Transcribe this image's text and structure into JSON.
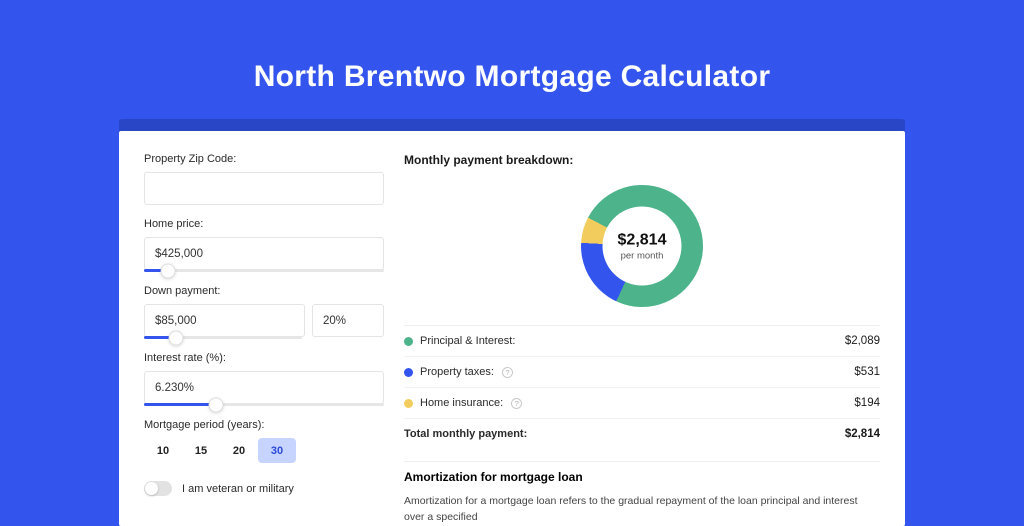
{
  "title": "North Brentwo Mortgage Calculator",
  "colors": {
    "principal": "#4cb38a",
    "taxes": "#3355ee",
    "insurance": "#f2cd5d"
  },
  "form": {
    "zip_label": "Property Zip Code:",
    "zip_value": "",
    "home_price_label": "Home price:",
    "home_price": "$425,000",
    "home_price_slider_pct": 10,
    "down_label": "Down payment:",
    "down_amount": "$85,000",
    "down_pct": "20%",
    "down_slider_pct": 20,
    "rate_label": "Interest rate (%):",
    "rate": "6.230%",
    "rate_slider_pct": 30,
    "period_label": "Mortgage period (years):",
    "periods": [
      "10",
      "15",
      "20",
      "30"
    ],
    "period_active": "30",
    "veteran_label": "I am veteran or military"
  },
  "breakdown": {
    "title": "Monthly payment breakdown:",
    "center_amount": "$2,814",
    "center_sub": "per month",
    "items": [
      {
        "key": "principal",
        "label": "Principal & Interest:",
        "value": "$2,089",
        "help": false
      },
      {
        "key": "taxes",
        "label": "Property taxes:",
        "value": "$531",
        "help": true
      },
      {
        "key": "insurance",
        "label": "Home insurance:",
        "value": "$194",
        "help": true
      }
    ],
    "total_label": "Total monthly payment:",
    "total_value": "$2,814"
  },
  "chart_data": {
    "type": "pie",
    "title": "Monthly payment breakdown",
    "categories": [
      "Principal & Interest",
      "Property taxes",
      "Home insurance"
    ],
    "values": [
      2089,
      531,
      194
    ],
    "total": 2814,
    "unit": "$ per month"
  },
  "amort": {
    "title": "Amortization for mortgage loan",
    "body": "Amortization for a mortgage loan refers to the gradual repayment of the loan principal and interest over a specified"
  }
}
